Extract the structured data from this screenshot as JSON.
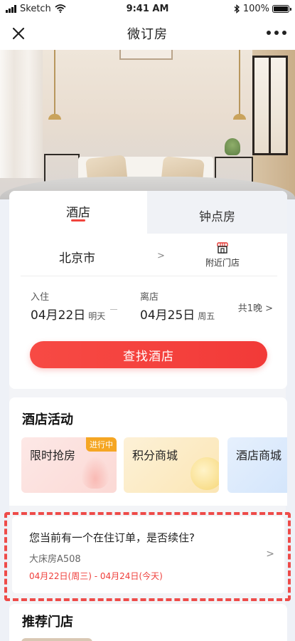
{
  "status_bar": {
    "carrier": "Sketch",
    "time": "9:41 AM",
    "battery": "100%"
  },
  "navbar": {
    "title": "微订房"
  },
  "booking": {
    "tabs": [
      "酒店",
      "钟点房"
    ],
    "city": "北京市",
    "nearby_label": "附近门店",
    "checkin_label": "入住",
    "checkin_date": "04月22日",
    "checkin_weekday": "明天",
    "checkout_label": "离店",
    "checkout_date": "04月25日",
    "checkout_weekday": "周五",
    "nights": "共1晚 ",
    "search_button": "查找酒店",
    "accent_color": "#f0433c"
  },
  "activities": {
    "title": "酒店活动",
    "items": [
      {
        "name": "限时抢房",
        "badge": "进行中"
      },
      {
        "name": "积分商城"
      },
      {
        "name": "酒店商城"
      }
    ]
  },
  "ongoing_order": {
    "question": "您当前有一个在住订单，是否续住?",
    "room": "大床房A508",
    "range": "04月22日(周三) - 04月24日(今天)"
  },
  "recommended": {
    "title": "推荐门店"
  }
}
